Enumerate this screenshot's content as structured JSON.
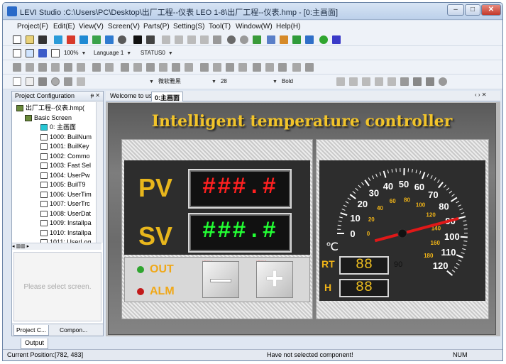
{
  "window": {
    "title": "LEVI Studio  :C:\\Users\\PC\\Desktop\\出厂工程--仪表 LEO 1-8\\出厂工程--仪表.hmp  - [0:主画面]",
    "min_label": "–",
    "max_label": "□",
    "close_label": "✕"
  },
  "menu": [
    "Project(F)",
    "Edit(E)",
    "View(V)",
    "Screen(V)",
    "Parts(P)",
    "Setting(S)",
    "Tool(T)",
    "Window(W)",
    "Help(H)"
  ],
  "toolbar": {
    "zoom": "100%",
    "language": "Language 1",
    "status": "STATUS0",
    "font": "微软雅黑",
    "font_size": "28",
    "font_weight": "Bold"
  },
  "project_panel": {
    "title": "Project Configuration",
    "pin": "ᵽ ✕",
    "tree": [
      {
        "label": "出厂工程--仪表.hmp(",
        "icon": "book"
      },
      {
        "label": "Basic Screen",
        "icon": "book"
      },
      {
        "label": "0: 主画面",
        "icon": "cyan"
      },
      {
        "label": "1000: BuilNum",
        "icon": "scr"
      },
      {
        "label": "1001: BuilKey",
        "icon": "scr"
      },
      {
        "label": "1002: Commo",
        "icon": "scr"
      },
      {
        "label": "1003: Fast Sel",
        "icon": "scr"
      },
      {
        "label": "1004: UserPw",
        "icon": "scr"
      },
      {
        "label": "1005: BuilT9",
        "icon": "scr"
      },
      {
        "label": "1006: UserTim",
        "icon": "scr"
      },
      {
        "label": "1007: UserTrc",
        "icon": "scr"
      },
      {
        "label": "1008: UserDat",
        "icon": "scr"
      },
      {
        "label": "1009: Installpa",
        "icon": "scr"
      },
      {
        "label": "1010: Installpa",
        "icon": "scr"
      },
      {
        "label": "1011: UserLog",
        "icon": "scr"
      }
    ],
    "hscroll_label": "◂  ▥▥  ▸",
    "preview_text": "Please select screen.",
    "tabs": [
      "Project C...",
      "Compon..."
    ]
  },
  "doc_tabs": {
    "tabs": [
      "Welcome to use",
      "0:主画面"
    ],
    "nav": "‹ › ✕"
  },
  "hmi": {
    "title": "Intelligent temperature controller",
    "pv_label": "PV",
    "sv_label": "SV",
    "pv_value": "###.#",
    "sv_value": "###.#",
    "out_label": "OUT",
    "alm_label": "ALM",
    "minus_tag": "HDX0.1",
    "plus_tag": "HDX0.2",
    "rt_label": "RT",
    "h_label": "H",
    "rt_value": "88",
    "h_value": "88",
    "reading": "90",
    "unit": "℃",
    "gauge_outer": [
      "0",
      "10",
      "20",
      "30",
      "40",
      "50",
      "60",
      "70",
      "80",
      "90",
      "100",
      "110",
      "120"
    ],
    "gauge_inner": [
      "0",
      "20",
      "40",
      "60",
      "80",
      "100",
      "120",
      "140",
      "160",
      "180"
    ],
    "pointer_value": 90
  },
  "output_tab": "Output",
  "status": {
    "position": "Current Position:[782, 483]",
    "selection": "Have not selected component!",
    "num": "NUM"
  },
  "colors": {
    "title_yellow": "#f2c42a",
    "digit_red": "#ff2020",
    "digit_green": "#22ff33",
    "led_on": "#2fa52f",
    "led_alarm": "#c21a1a"
  }
}
